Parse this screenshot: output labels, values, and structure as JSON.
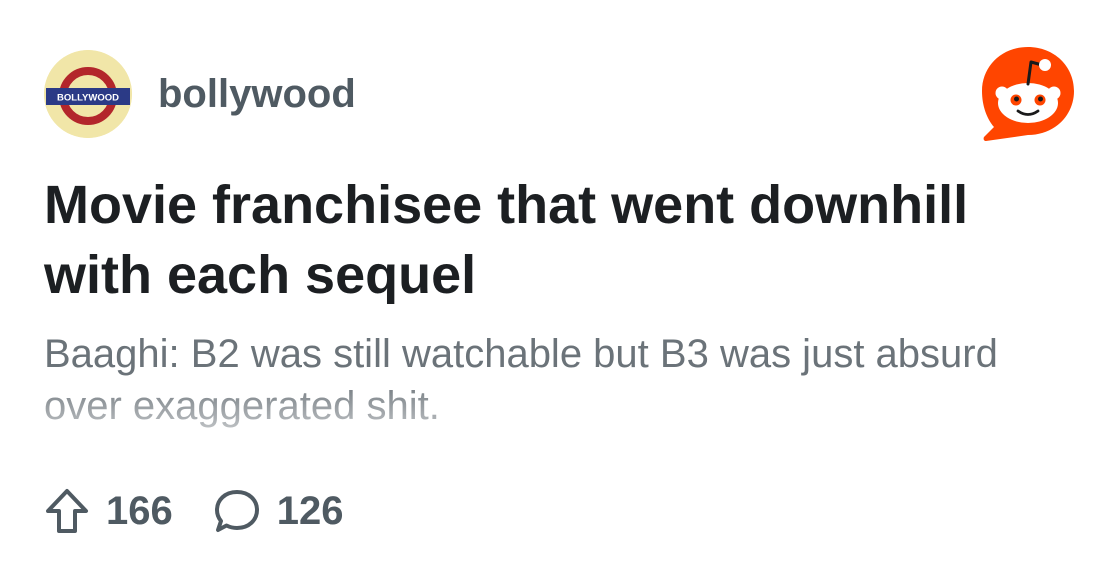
{
  "subreddit": {
    "name": "bollywood",
    "avatar_text": "BOLLYWOOD"
  },
  "post": {
    "title": "Movie franchisee that went downhill with each sequel",
    "body": "Baaghi: B2 was still watchable but B3 was just absurd over exaggerated shit."
  },
  "stats": {
    "upvotes": "166",
    "comments": "126"
  },
  "icons": {
    "upvote": "upvote-arrow-icon",
    "comment": "comment-bubble-icon",
    "logo": "reddit-logo-icon"
  },
  "colors": {
    "reddit_orange": "#ff4500",
    "title": "#1c1f22",
    "meta": "#4f5a62",
    "body": "#6b7379"
  }
}
